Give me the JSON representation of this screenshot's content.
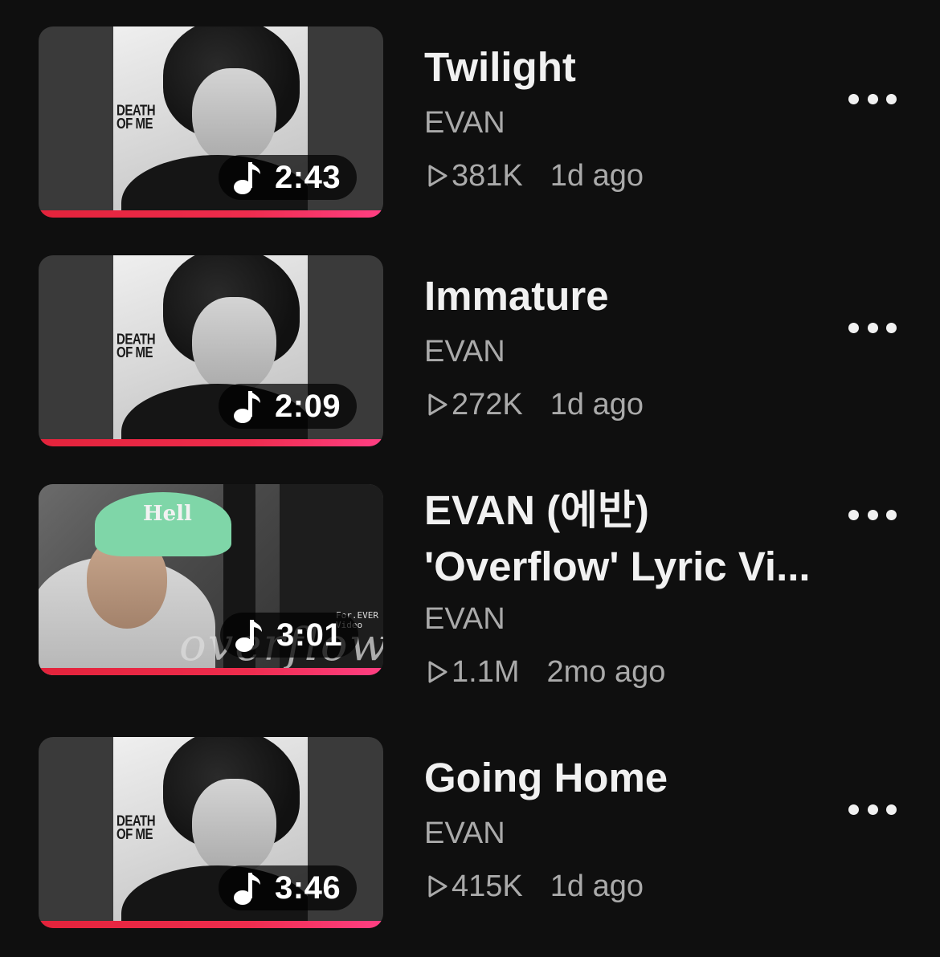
{
  "videos": [
    {
      "title": "Twilight",
      "channel": "EVAN",
      "views": "381K",
      "age": "1d ago",
      "duration": "2:43",
      "thumbnail_style": "album-art",
      "album_text": "DEATH OF ME"
    },
    {
      "title": "Immature",
      "channel": "EVAN",
      "views": "272K",
      "age": "1d ago",
      "duration": "2:09",
      "thumbnail_style": "album-art",
      "album_text": "DEATH OF ME"
    },
    {
      "title": "EVAN (에반) 'Overflow' Lyric Vi...",
      "title_line1": "EVAN (에반)",
      "title_line2": "'Overflow' Lyric Vi...",
      "channel": "EVAN",
      "views": "1.1M",
      "age": "2mo ago",
      "duration": "3:01",
      "thumbnail_style": "photo",
      "cap_text": "Hell",
      "overlay_script": "overflow",
      "overlay_tag": "For.EVER Video"
    },
    {
      "title": "Going Home",
      "channel": "EVAN",
      "views": "415K",
      "age": "1d ago",
      "duration": "3:46",
      "thumbnail_style": "album-art",
      "album_text": "DEATH OF ME"
    }
  ],
  "icons": {
    "duration_badge": "music-note-icon",
    "views": "play-outline-icon",
    "menu": "more-horizontal-icon"
  },
  "colors": {
    "background": "#0f0f0f",
    "progress": "#e3233b",
    "text_primary": "#f1f1f1",
    "text_secondary": "#aaaaaa"
  }
}
